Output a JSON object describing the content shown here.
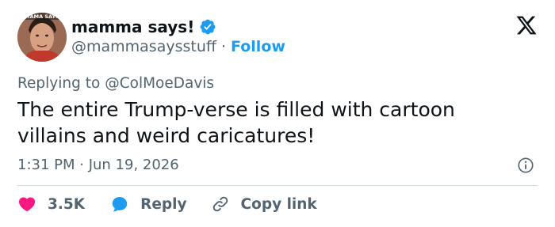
{
  "author": {
    "display_name": "mamma says!",
    "handle": "@mammasaysstuff",
    "separator": "·",
    "follow_label": "Follow",
    "avatar_caption": "MAMA SAYS",
    "verified_icon": "verified-badge-icon"
  },
  "reply_context": {
    "prefix": "Replying to",
    "mention": "@ColMoeDavis"
  },
  "tweet": {
    "text": "The entire Trump-verse is filled with cartoon\nvillains and weird caricatures!",
    "timestamp": "1:31 PM · Jun 19, 2026"
  },
  "actions": {
    "like_count": "3.5K",
    "reply_label": "Reply",
    "copy_link_label": "Copy link"
  },
  "colors": {
    "brand_blue": "#1d9bf0",
    "like_pink": "#f91880",
    "muted_text": "#536471",
    "main_text": "#0f1419",
    "divider": "#cfd9de"
  }
}
